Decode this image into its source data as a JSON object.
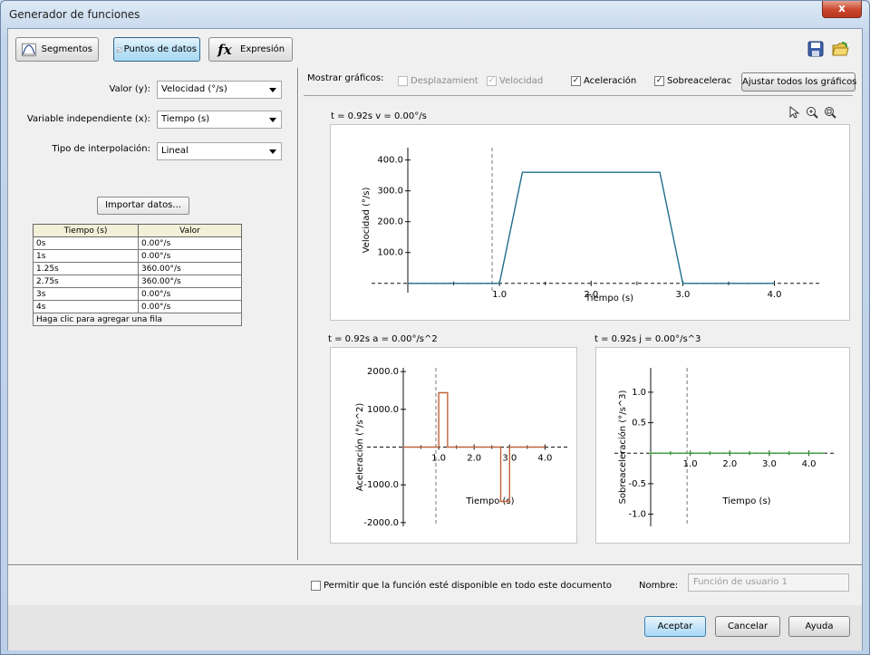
{
  "window": {
    "title": "Generador de funciones",
    "close_glyph": "x"
  },
  "toolbar": {
    "segmentos_label": "Segmentos",
    "puntos_label": "Puntos de datos",
    "expresion_label": "Expresión",
    "expresion_icon_text": "fx",
    "save_icon": "save-icon",
    "open_icon": "open-folder-icon"
  },
  "form": {
    "valor_label": "Valor (y):",
    "valor_value": "Velocidad (°/s)",
    "variable_label": "Variable independiente (x):",
    "variable_value": "Tiempo (s)",
    "interp_label": "Tipo de interpolación:",
    "interp_value": "Lineal",
    "import_label": "Importar datos..."
  },
  "table": {
    "headers": [
      "Tiempo (s)",
      "Valor"
    ],
    "rows": [
      [
        "0s",
        "0.00°/s"
      ],
      [
        "1s",
        "0.00°/s"
      ],
      [
        "1.25s",
        "360.00°/s"
      ],
      [
        "2.75s",
        "360.00°/s"
      ],
      [
        "3s",
        "0.00°/s"
      ],
      [
        "4s",
        "0.00°/s"
      ]
    ],
    "add_row_hint": "Haga clic para agregar una fila"
  },
  "graphs_bar": {
    "label": "Mostrar gráficos:",
    "desplazamiento": "Desplazamient",
    "velocidad": "Velocidad",
    "aceleracion": "Aceleración",
    "sobreaceleracion": "Sobreacelerac",
    "fit_all": "Ajustar todos los gráficos",
    "check_glyph": "✓"
  },
  "readouts": {
    "velocity": "t = 0.92s  v = 0.00°/s",
    "acceleration": "t = 0.92s  a = 0.00°/s^2",
    "jerk": "t = 0.92s  j = 0.00°/s^3"
  },
  "colors": {
    "velocity": "#1f6e8c",
    "acceleration": "#c0623a",
    "jerk": "#3a9a3a",
    "dashed_axis": "#4a7fa0"
  },
  "chart_data": [
    {
      "type": "line",
      "xlabel": "Tiempo (s)",
      "ylabel": "Velocidad (°/s)",
      "x": [
        0,
        1,
        1.25,
        2.75,
        3,
        4
      ],
      "y": [
        0,
        0,
        360,
        360,
        0,
        0
      ],
      "xlim": [
        0,
        4.4
      ],
      "ylim": [
        -30,
        440
      ],
      "xticks": [
        "1.0",
        "2.0",
        "3.0",
        "4.0"
      ],
      "yticks": [
        "100.0",
        "200.0",
        "300.0",
        "400.0"
      ],
      "cursor_x": 0.92
    },
    {
      "type": "line",
      "xlabel": "Tiempo (s)",
      "ylabel": "Aceleración (°/s^2)",
      "x": [
        0,
        1,
        1,
        1.25,
        1.25,
        2.75,
        2.75,
        3,
        3,
        4
      ],
      "y": [
        0,
        0,
        1440,
        1440,
        0,
        0,
        -1440,
        -1440,
        0,
        0
      ],
      "xlim": [
        0,
        4.4
      ],
      "ylim": [
        -2100,
        2100
      ],
      "xticks": [
        "1.0",
        "2.0",
        "3.0",
        "4.0"
      ],
      "yticks": [
        "-2000.0",
        "-1000.0",
        "1000.0",
        "2000.0"
      ],
      "cursor_x": 0.92
    },
    {
      "type": "line",
      "xlabel": "Tiempo (s)",
      "ylabel": "Sobreaceleración (°/s^3)",
      "x": [
        0,
        4.4
      ],
      "y": [
        0,
        0
      ],
      "xlim": [
        0,
        4.4
      ],
      "ylim": [
        -1.2,
        1.4
      ],
      "xticks": [
        "1.0",
        "2.0",
        "3.0",
        "4.0"
      ],
      "yticks": [
        "-1.0",
        "-0.5",
        "0.5",
        "1.0"
      ],
      "cursor_x": 0.92
    }
  ],
  "bottom": {
    "permit_label": "Permitir que la función esté disponible en todo este documento",
    "name_label": "Nombre:",
    "name_placeholder": "Función de usuario 1",
    "ok": "Aceptar",
    "cancel": "Cancelar",
    "help": "Ayuda"
  }
}
